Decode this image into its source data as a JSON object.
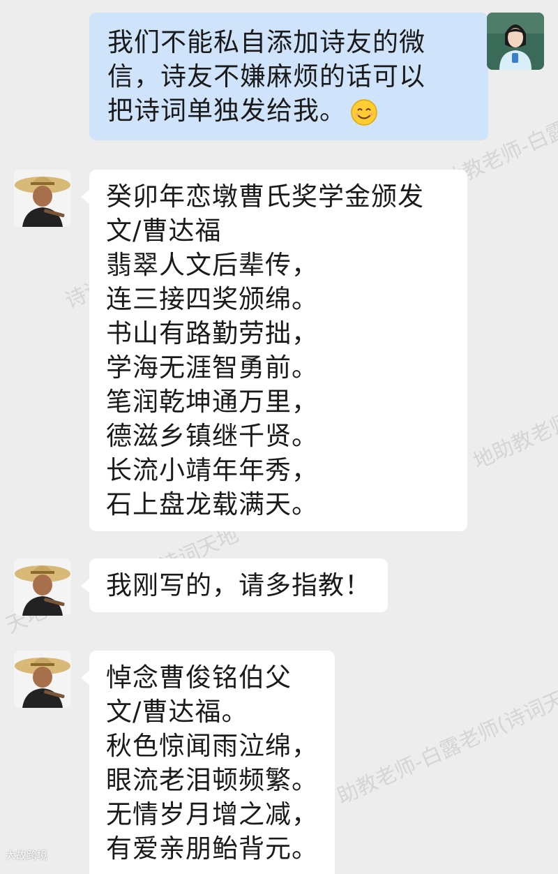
{
  "watermarks": [
    "地助教老师-白露老师(诗",
    "诗词",
    "地助教老师",
    "诗词天地",
    "助教老师-白露老师(诗词天",
    "天地"
  ],
  "messages": [
    {
      "sender": "teacher",
      "lines": [
        "我们不能私自添加诗友的微",
        "信，诗友不嫌麻烦的话可以",
        "把诗词单独发给我。"
      ],
      "emoji": "smiling-face-icon"
    },
    {
      "sender": "poet",
      "lines": [
        "癸卯年恋墩曹氏奖学金颁发",
        "文/曹达福",
        "翡翠人文后辈传，",
        "连三接四奖颁绵。",
        "书山有路勤劳拙，",
        "学海无涯智勇前。",
        "笔润乾坤通万里，",
        "德滋乡镇继千贤。",
        "长流小靖年年秀，",
        "石上盘龙载满天。"
      ]
    },
    {
      "sender": "poet",
      "lines": [
        "我刚写的，请多指教！"
      ]
    },
    {
      "sender": "poet",
      "lines": [
        "悼念曹俊铭伯父",
        "文/曹达福。",
        "秋色惊闻雨泣绵，",
        "眼流老泪顿频繁。",
        "无情岁月增之减，",
        "有爱亲朋鲐背元。"
      ]
    }
  ],
  "corner_logo": "大故跨境"
}
